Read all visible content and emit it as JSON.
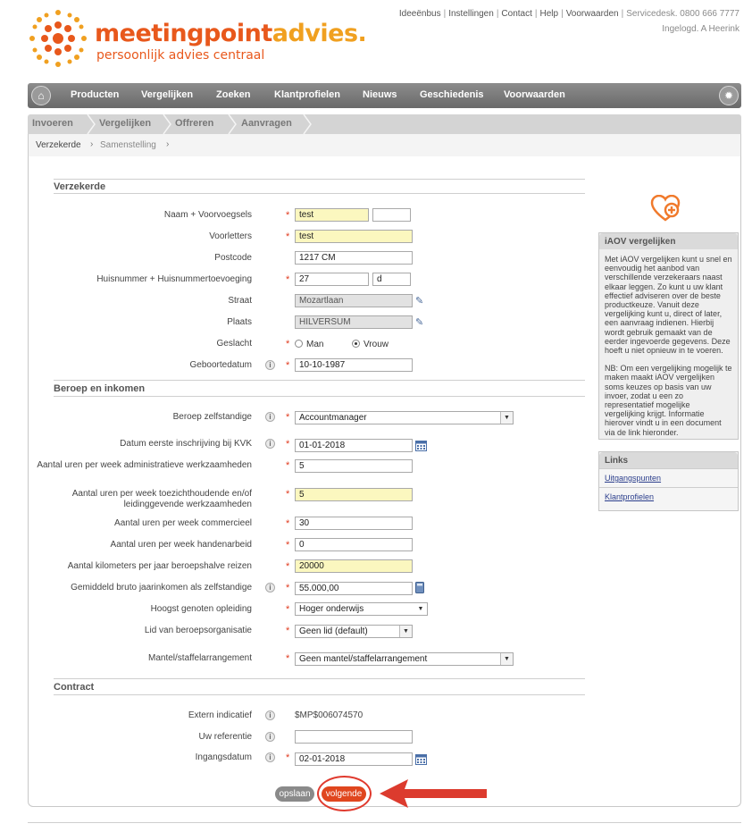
{
  "brand": {
    "name_part1": "meetingpoint",
    "name_part2": "advies.",
    "tagline": "persoonlijk advies centraal"
  },
  "toplinks": [
    "Ideeënbus",
    "Instellingen",
    "Contact",
    "Help",
    "Voorwaarden"
  ],
  "servicedesk": "Servicedesk. 0800 666 7777",
  "logged_in": "Ingelogd. A Heerink",
  "nav": [
    "Producten",
    "Vergelijken",
    "Zoeken",
    "Klantprofielen",
    "Nieuws",
    "Geschiedenis",
    "Voorwaarden"
  ],
  "steps": [
    "Invoeren",
    "Vergelijken",
    "Offreren",
    "Aanvragen"
  ],
  "substeps": [
    "Verzekerde",
    "Samenstelling"
  ],
  "sections": {
    "verzekerde": "Verzekerde",
    "beroep": "Beroep en inkomen",
    "contract": "Contract"
  },
  "form": {
    "naam_label": "Naam + Voorvoegsels",
    "naam_value": "test",
    "voorvoegsel_value": "",
    "voorletters_label": "Voorletters",
    "voorletters_value": "test",
    "postcode_label": "Postcode",
    "postcode_value": "1217 CM",
    "huisnummer_label": "Huisnummer + Huisnummertoevoeging",
    "huisnummer_value": "27",
    "toevoeging_value": "d",
    "straat_label": "Straat",
    "straat_value": "Mozartlaan",
    "plaats_label": "Plaats",
    "plaats_value": "HILVERSUM",
    "geslacht_label": "Geslacht",
    "geslacht_man": "Man",
    "geslacht_vrouw": "Vrouw",
    "geslacht_selected": "Vrouw",
    "geboortedatum_label": "Geboortedatum",
    "geboortedatum_value": "10-10-1987",
    "beroep_label": "Beroep zelfstandige",
    "beroep_value": "Accountmanager",
    "kvk_label": "Datum eerste inschrijving bij KVK",
    "kvk_value": "01-01-2018",
    "admin_label": "Aantal uren per week administratieve werkzaamheden",
    "admin_value": "5",
    "toezicht_label": "Aantal uren per week toezichthoudende en/of leidinggevende werkzaamheden",
    "toezicht_value": "5",
    "commercieel_label": "Aantal uren per week commercieel",
    "commercieel_value": "30",
    "handenarbeid_label": "Aantal uren per week handenarbeid",
    "handenarbeid_value": "0",
    "km_label": "Aantal kilometers per jaar beroepshalve reizen",
    "km_value": "20000",
    "inkomen_label": "Gemiddeld bruto jaarinkomen als zelfstandige",
    "inkomen_value": "55.000,00",
    "opleiding_label": "Hoogst genoten opleiding",
    "opleiding_value": "Hoger onderwijs",
    "lid_label": "Lid van beroepsorganisatie",
    "lid_value": "Geen lid (default)",
    "mantel_label": "Mantel/staffelarrangement",
    "mantel_value": "Geen mantel/staffelarrangement",
    "extern_label": "Extern indicatief",
    "extern_value": "$MP$006074570",
    "referentie_label": "Uw referentie",
    "referentie_value": "",
    "ingangsdatum_label": "Ingangsdatum",
    "ingangsdatum_value": "02-01-2018"
  },
  "sidebar": {
    "iaov_title": "iAOV vergelijken",
    "iaov_text1": "Met iAOV vergelijken kunt u snel en eenvoudig het aanbod van verschillende verzekeraars naast elkaar leggen. Zo kunt u uw klant effectief adviseren over de beste productkeuze. Vanuit deze vergelijking kunt u, direct of later, een aanvraag indienen. Hierbij wordt gebruik gemaakt van de eerder ingevoerde gegevens. Deze hoeft u niet opnieuw in te voeren.",
    "iaov_text2": "NB: Om een vergelijking mogelijk te maken maakt iAOV vergelijken soms keuzes op basis van uw invoer, zodat u een zo representatief mogelijke vergelijking krijgt. Informatie hierover vindt u in een document via de link hieronder.",
    "links_title": "Links",
    "links": [
      "Uitgangspunten",
      "Klantprofielen"
    ]
  },
  "buttons": {
    "save": "opslaan",
    "next": "volgende"
  },
  "colors": {
    "brand_orange": "#e8581c",
    "brand_yellow": "#f0a020",
    "nav_grey": "#7a7a7a",
    "highlight_field": "#fbf7bf",
    "next_button": "#e0461e",
    "annotation_red": "#e03a2e"
  }
}
